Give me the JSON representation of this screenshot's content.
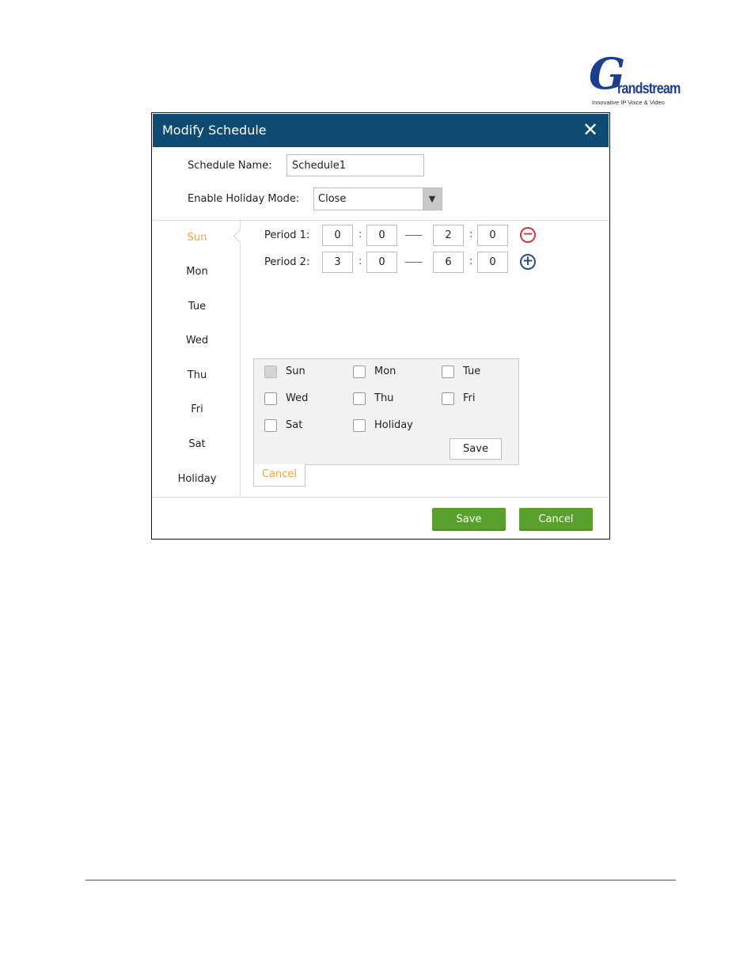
{
  "logo": {
    "mark": "G",
    "word": "randstream",
    "tagline": "Innovative IP Voice & Video"
  },
  "dialog": {
    "title": "Modify Schedule",
    "close_glyph": "✕",
    "schedule_name_label": "Schedule Name:",
    "schedule_name_value": "Schedule1",
    "holiday_mode_label": "Enable Holiday Mode:",
    "holiday_mode_value": "Close",
    "select_arrow": "▼"
  },
  "days": {
    "active": "Sun",
    "items": [
      "Sun",
      "Mon",
      "Tue",
      "Wed",
      "Thu",
      "Fri",
      "Sat",
      "Holiday"
    ]
  },
  "periods": [
    {
      "label": "Period 1:",
      "start_h": "0",
      "start_m": "0",
      "end_h": "2",
      "end_m": "0",
      "action": "remove",
      "action_glyph": "−"
    },
    {
      "label": "Period 2:",
      "start_h": "3",
      "start_m": "0",
      "end_h": "6",
      "end_m": "0",
      "action": "add",
      "action_glyph": "+"
    }
  ],
  "separators": {
    "colon": ":",
    "dash": "——"
  },
  "copy_panel": {
    "checkboxes": [
      {
        "label": "Sun",
        "disabled": true
      },
      {
        "label": "Mon",
        "disabled": false
      },
      {
        "label": "Tue",
        "disabled": false
      },
      {
        "label": "Wed",
        "disabled": false
      },
      {
        "label": "Thu",
        "disabled": false
      },
      {
        "label": "Fri",
        "disabled": false
      },
      {
        "label": "Sat",
        "disabled": false
      },
      {
        "label": "Holiday",
        "disabled": false
      }
    ],
    "save_label": "Save",
    "cancel_label": "Cancel"
  },
  "footer_buttons": {
    "save_label": "Save",
    "cancel_label": "Cancel"
  },
  "colors": {
    "titlebar": "#0e4a72",
    "accent_orange": "#f5a23a",
    "button_green": "#5aa02c",
    "remove_red": "#d13a3a",
    "add_blue": "#2a4f86"
  }
}
